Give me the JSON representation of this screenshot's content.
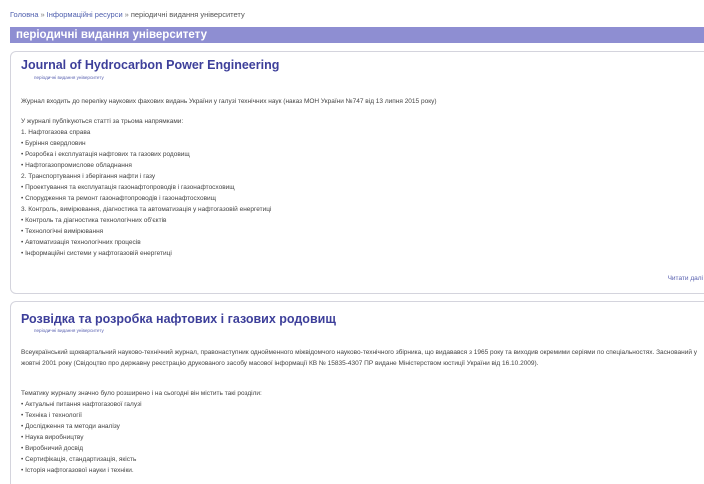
{
  "breadcrumb": {
    "home": "Головна",
    "info": "Інформаційні ресурси",
    "current": "періодичні видання університету"
  },
  "section_title": "періодичні видання університету",
  "articles": [
    {
      "title": "Journal of Hydrocarbon Power Engineering",
      "category": "періодичні видання університету",
      "lines": [
        "Журнал входить до переліку наукових фахових видань України у галузі технічних наук (наказ МОН України №747 від 13 липня 2015 року)",
        "У журналі публікуються статті за трьома напрямками:",
        "1. Нафтогазова справа",
        "• Буріння свердловин",
        "• Розробка і експлуатація нафтових та газових родовищ",
        "• Нафтогазопромислове обладнання",
        "2. Транспортування і зберігання нафти і газу",
        "• Проектування та експлуатація газонафтопроводів і газонафтосховищ",
        "• Спорудження та ремонт газонафтопроводів і газонафтосховищ",
        "3. Контроль, вимірювання, діагностика та автоматизація у нафтогазовій енергетиці",
        "• Контроль та діагностика технологічних об'єктів",
        "• Технологічні вимірювання",
        "• Автоматизація технологічних процесів",
        "• Інформаційні системи у нафтогазовій енергетиці"
      ],
      "read_more": "Читати далі"
    },
    {
      "title": "Розвідка та розробка нафтових і газових родовищ",
      "category": "періодичні видання університету",
      "intro": "Всеукраїнський щоквартальний науково-технічний журнал, правонаступник однойменного міжвідомчого науково-технічного збірника, що видавався з 1965 року та виходив окремими серіями по спеціальностях. Заснований у жовтні 2001 року (Свідоцтво про державну реєстрацію друкованого засобу масової інформації КВ № 15835-4307 ПР видане Міністерством юстиції України від 16.10.2009).",
      "lines": [
        "Тематику журналу значно було розширено і на сьогодні він містить такі розділи:",
        "• Актуальні питання нафтогазової галузі",
        "• Техніка і технології",
        "• Дослідження та методи аналізу",
        "• Наука виробництву",
        "• Виробничий досвід",
        "• Сертифікація, стандартизація, якість",
        "• Історія нафтогазової науки і техніки."
      ]
    }
  ]
}
